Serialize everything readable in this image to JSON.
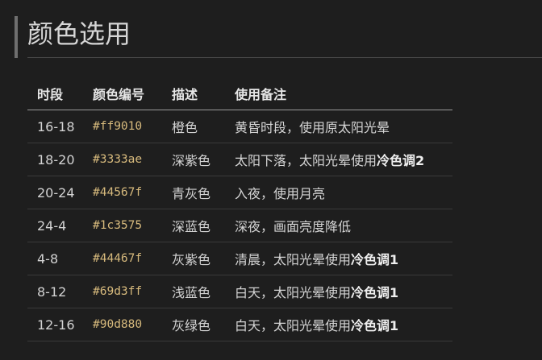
{
  "heading": {
    "title": "颜色选用"
  },
  "table": {
    "headers": [
      "时段",
      "颜色编号",
      "描述",
      "使用备注"
    ],
    "rows": [
      {
        "period": "16-18",
        "code": "#ff9010",
        "desc": "橙色",
        "note": "黄昏时段，使用原太阳光晕",
        "note_bold": ""
      },
      {
        "period": "18-20",
        "code": "#3333ae",
        "desc": "深紫色",
        "note": "太阳下落，太阳光晕使用",
        "note_bold": "冷色调2"
      },
      {
        "period": "20-24",
        "code": "#44567f",
        "desc": "青灰色",
        "note": "入夜，使用月亮",
        "note_bold": ""
      },
      {
        "period": "24-4",
        "code": "#1c3575",
        "desc": "深蓝色",
        "note": "深夜，画面亮度降低",
        "note_bold": ""
      },
      {
        "period": "4-8",
        "code": "#44467f",
        "desc": "灰紫色",
        "note": "清晨，太阳光晕使用",
        "note_bold": "冷色调1"
      },
      {
        "period": "8-12",
        "code": "#69d3ff",
        "desc": "浅蓝色",
        "note": "白天，太阳光晕使用",
        "note_bold": "冷色调1"
      },
      {
        "period": "12-16",
        "code": "#90d880",
        "desc": "灰绿色",
        "note": "白天，太阳光晕使用",
        "note_bold": "冷色调1"
      }
    ]
  },
  "colors": {
    "background": "#1e1e1e",
    "text": "#d4d4d4",
    "code": "#d7ba7d",
    "heading_bar": "#6f6f6f"
  }
}
